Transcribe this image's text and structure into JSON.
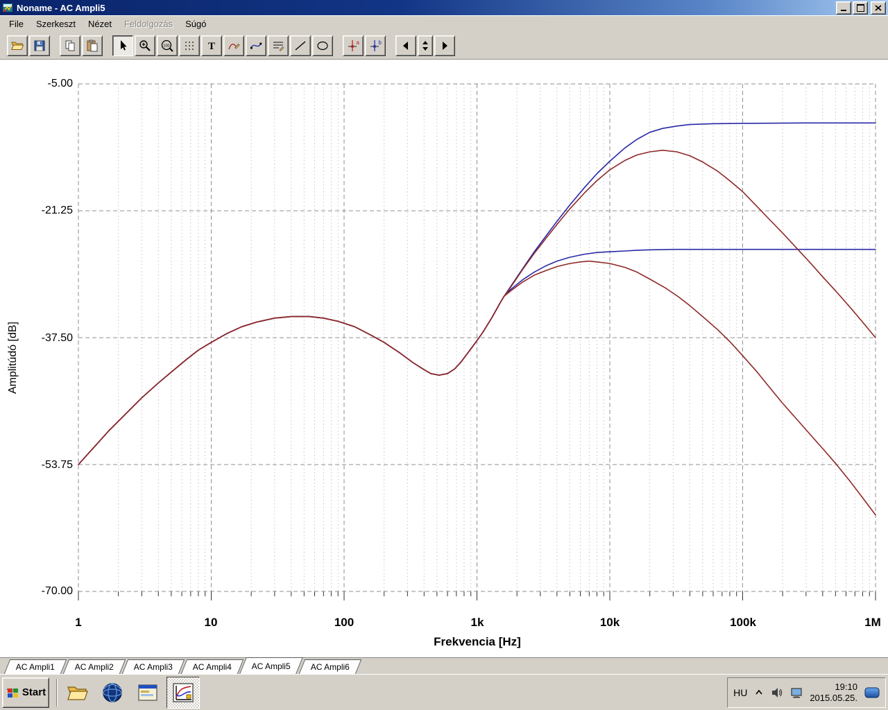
{
  "window": {
    "title": "Noname - AC Ampli5"
  },
  "menu": {
    "items": [
      {
        "label": "File",
        "enabled": true
      },
      {
        "label": "Szerkeszt",
        "enabled": true
      },
      {
        "label": "Nézet",
        "enabled": true
      },
      {
        "label": "Feldolgozás",
        "enabled": false
      },
      {
        "label": "Súgó",
        "enabled": true
      }
    ]
  },
  "toolbar": {
    "text_tool_label": "T",
    "zoom_100_label": "100",
    "cursor_a_label": "a",
    "cursor_b_label": "b"
  },
  "chart_data": {
    "type": "line",
    "title": "",
    "xlabel": "Frekvencia [Hz]",
    "ylabel": "Amplitúdó [dB]",
    "x_scale": "log",
    "xlim": [
      1,
      1000000
    ],
    "ylim": [
      -70,
      -5
    ],
    "y_ticks": [
      -5,
      -21.25,
      -37.5,
      -53.75,
      -70
    ],
    "y_tick_labels": [
      "-5.00",
      "-21.25",
      "-37.50",
      "-53.75",
      "-70.00"
    ],
    "x_ticks": [
      1,
      10,
      100,
      1000,
      10000,
      100000,
      1000000
    ],
    "x_tick_labels": [
      "1",
      "10",
      "100",
      "1k",
      "10k",
      "100k",
      "1M"
    ],
    "grid": true,
    "grid_major_color": "#8f8f8f",
    "grid_minor_color": "#c6c6c6",
    "blue_color": "#2828a8",
    "red_color": "#8f2828",
    "series": [
      {
        "name": "blue_upper",
        "color": "#2828a8",
        "points": [
          [
            1,
            -53.75
          ],
          [
            1.3,
            -51.6
          ],
          [
            1.7,
            -49.4
          ],
          [
            2.2,
            -47.5
          ],
          [
            3,
            -45.2
          ],
          [
            4,
            -43.3
          ],
          [
            5,
            -41.9
          ],
          [
            6.5,
            -40.3
          ],
          [
            8,
            -39.1
          ],
          [
            10,
            -38.1
          ],
          [
            13,
            -37
          ],
          [
            17,
            -36.1
          ],
          [
            22,
            -35.5
          ],
          [
            30,
            -35
          ],
          [
            40,
            -34.8
          ],
          [
            55,
            -34.8
          ],
          [
            70,
            -35
          ],
          [
            90,
            -35.4
          ],
          [
            120,
            -36.1
          ],
          [
            160,
            -37.2
          ],
          [
            200,
            -38.1
          ],
          [
            260,
            -39.4
          ],
          [
            330,
            -40.7
          ],
          [
            400,
            -41.6
          ],
          [
            450,
            -42.1
          ],
          [
            520,
            -42.3
          ],
          [
            600,
            -42.1
          ],
          [
            680,
            -41.5
          ],
          [
            760,
            -40.6
          ],
          [
            850,
            -39.5
          ],
          [
            950,
            -38.4
          ],
          [
            1100,
            -36.9
          ],
          [
            1300,
            -34.9
          ],
          [
            1500,
            -33
          ],
          [
            1600,
            -32.2
          ],
          [
            1800,
            -30.9
          ],
          [
            2200,
            -28.7
          ],
          [
            2700,
            -26.5
          ],
          [
            3300,
            -24.5
          ],
          [
            4000,
            -22.6
          ],
          [
            5000,
            -20.5
          ],
          [
            6500,
            -18.2
          ],
          [
            8000,
            -16.5
          ],
          [
            10000,
            -14.9
          ],
          [
            13000,
            -13.2
          ],
          [
            16000,
            -12.1
          ],
          [
            20000,
            -11.2
          ],
          [
            25000,
            -10.7
          ],
          [
            32000,
            -10.4
          ],
          [
            40000,
            -10.2
          ],
          [
            60000,
            -10.1
          ],
          [
            100000,
            -10.05
          ],
          [
            300000,
            -10
          ],
          [
            1000000,
            -10
          ]
        ]
      },
      {
        "name": "blue_lower",
        "color": "#2828a8",
        "points": [
          [
            1,
            -53.75
          ],
          [
            1.3,
            -51.6
          ],
          [
            1.7,
            -49.4
          ],
          [
            2.2,
            -47.5
          ],
          [
            3,
            -45.2
          ],
          [
            4,
            -43.3
          ],
          [
            5,
            -41.9
          ],
          [
            6.5,
            -40.3
          ],
          [
            8,
            -39.1
          ],
          [
            10,
            -38.1
          ],
          [
            13,
            -37
          ],
          [
            17,
            -36.1
          ],
          [
            22,
            -35.5
          ],
          [
            30,
            -35
          ],
          [
            40,
            -34.8
          ],
          [
            55,
            -34.8
          ],
          [
            70,
            -35
          ],
          [
            90,
            -35.4
          ],
          [
            120,
            -36.1
          ],
          [
            160,
            -37.2
          ],
          [
            200,
            -38.1
          ],
          [
            260,
            -39.4
          ],
          [
            330,
            -40.7
          ],
          [
            400,
            -41.6
          ],
          [
            450,
            -42.1
          ],
          [
            520,
            -42.3
          ],
          [
            600,
            -42.1
          ],
          [
            680,
            -41.5
          ],
          [
            760,
            -40.6
          ],
          [
            850,
            -39.5
          ],
          [
            950,
            -38.4
          ],
          [
            1100,
            -36.9
          ],
          [
            1300,
            -34.9
          ],
          [
            1500,
            -33
          ],
          [
            1600,
            -32.2
          ],
          [
            1800,
            -31.3
          ],
          [
            2200,
            -30.1
          ],
          [
            2700,
            -29.1
          ],
          [
            3300,
            -28.3
          ],
          [
            4000,
            -27.7
          ],
          [
            5000,
            -27.2
          ],
          [
            6500,
            -26.8
          ],
          [
            8000,
            -26.6
          ],
          [
            10000,
            -26.5
          ],
          [
            13000,
            -26.4
          ],
          [
            16000,
            -26.3
          ],
          [
            20000,
            -26.25
          ],
          [
            30000,
            -26.2
          ],
          [
            60000,
            -26.2
          ],
          [
            100000,
            -26.2
          ],
          [
            300000,
            -26.2
          ],
          [
            1000000,
            -26.2
          ]
        ]
      },
      {
        "name": "red_upper",
        "color": "#8f2828",
        "points": [
          [
            1,
            -53.75
          ],
          [
            1.3,
            -51.6
          ],
          [
            1.7,
            -49.4
          ],
          [
            2.2,
            -47.5
          ],
          [
            3,
            -45.2
          ],
          [
            4,
            -43.3
          ],
          [
            5,
            -41.9
          ],
          [
            6.5,
            -40.3
          ],
          [
            8,
            -39.1
          ],
          [
            10,
            -38.1
          ],
          [
            13,
            -37
          ],
          [
            17,
            -36.1
          ],
          [
            22,
            -35.5
          ],
          [
            30,
            -35
          ],
          [
            40,
            -34.8
          ],
          [
            55,
            -34.8
          ],
          [
            70,
            -35
          ],
          [
            90,
            -35.4
          ],
          [
            120,
            -36.1
          ],
          [
            160,
            -37.2
          ],
          [
            200,
            -38.1
          ],
          [
            260,
            -39.4
          ],
          [
            330,
            -40.7
          ],
          [
            400,
            -41.6
          ],
          [
            450,
            -42.1
          ],
          [
            520,
            -42.3
          ],
          [
            600,
            -42.1
          ],
          [
            680,
            -41.5
          ],
          [
            760,
            -40.6
          ],
          [
            850,
            -39.5
          ],
          [
            950,
            -38.4
          ],
          [
            1100,
            -36.9
          ],
          [
            1300,
            -34.9
          ],
          [
            1500,
            -33
          ],
          [
            1600,
            -32.2
          ],
          [
            1800,
            -31
          ],
          [
            2200,
            -28.8
          ],
          [
            2700,
            -26.7
          ],
          [
            3300,
            -24.8
          ],
          [
            4000,
            -23
          ],
          [
            5000,
            -21
          ],
          [
            6500,
            -18.9
          ],
          [
            8000,
            -17.4
          ],
          [
            10000,
            -16
          ],
          [
            13000,
            -14.8
          ],
          [
            16000,
            -14.1
          ],
          [
            20000,
            -13.7
          ],
          [
            25000,
            -13.5
          ],
          [
            32000,
            -13.7
          ],
          [
            40000,
            -14.2
          ],
          [
            50000,
            -15
          ],
          [
            65000,
            -16.2
          ],
          [
            80000,
            -17.4
          ],
          [
            100000,
            -18.8
          ],
          [
            130000,
            -20.8
          ],
          [
            160000,
            -22.4
          ],
          [
            200000,
            -24.1
          ],
          [
            260000,
            -26.2
          ],
          [
            330000,
            -28.1
          ],
          [
            400000,
            -29.7
          ],
          [
            500000,
            -31.5
          ],
          [
            650000,
            -33.7
          ],
          [
            800000,
            -35.5
          ],
          [
            1000000,
            -37.5
          ]
        ]
      },
      {
        "name": "red_lower",
        "color": "#8f2828",
        "points": [
          [
            1,
            -53.75
          ],
          [
            1.3,
            -51.6
          ],
          [
            1.7,
            -49.4
          ],
          [
            2.2,
            -47.5
          ],
          [
            3,
            -45.2
          ],
          [
            4,
            -43.3
          ],
          [
            5,
            -41.9
          ],
          [
            6.5,
            -40.3
          ],
          [
            8,
            -39.1
          ],
          [
            10,
            -38.1
          ],
          [
            13,
            -37
          ],
          [
            17,
            -36.1
          ],
          [
            22,
            -35.5
          ],
          [
            30,
            -35
          ],
          [
            40,
            -34.8
          ],
          [
            55,
            -34.8
          ],
          [
            70,
            -35
          ],
          [
            90,
            -35.4
          ],
          [
            120,
            -36.1
          ],
          [
            160,
            -37.2
          ],
          [
            200,
            -38.1
          ],
          [
            260,
            -39.4
          ],
          [
            330,
            -40.7
          ],
          [
            400,
            -41.6
          ],
          [
            450,
            -42.1
          ],
          [
            520,
            -42.3
          ],
          [
            600,
            -42.1
          ],
          [
            680,
            -41.5
          ],
          [
            760,
            -40.6
          ],
          [
            850,
            -39.5
          ],
          [
            950,
            -38.4
          ],
          [
            1100,
            -36.9
          ],
          [
            1300,
            -34.9
          ],
          [
            1500,
            -33
          ],
          [
            1600,
            -32.2
          ],
          [
            1800,
            -31.5
          ],
          [
            2200,
            -30.4
          ],
          [
            2700,
            -29.5
          ],
          [
            3300,
            -28.9
          ],
          [
            4000,
            -28.4
          ],
          [
            5000,
            -28
          ],
          [
            6000,
            -27.8
          ],
          [
            7000,
            -27.7
          ],
          [
            8000,
            -27.8
          ],
          [
            10000,
            -28
          ],
          [
            13000,
            -28.5
          ],
          [
            16000,
            -29.1
          ],
          [
            20000,
            -30
          ],
          [
            26000,
            -31.1
          ],
          [
            33000,
            -32.3
          ],
          [
            40000,
            -33.4
          ],
          [
            50000,
            -34.8
          ],
          [
            65000,
            -36.5
          ],
          [
            80000,
            -38
          ],
          [
            100000,
            -39.8
          ],
          [
            130000,
            -42
          ],
          [
            160000,
            -43.9
          ],
          [
            200000,
            -45.9
          ],
          [
            260000,
            -48.1
          ],
          [
            330000,
            -50.1
          ],
          [
            400000,
            -51.7
          ],
          [
            500000,
            -53.6
          ],
          [
            650000,
            -56
          ],
          [
            800000,
            -58
          ],
          [
            1000000,
            -60.2
          ]
        ]
      }
    ]
  },
  "tabs": {
    "items": [
      {
        "label": "AC Ampli1",
        "active": false
      },
      {
        "label": "AC Ampli2",
        "active": false
      },
      {
        "label": "AC Ampli3",
        "active": false
      },
      {
        "label": "AC Ampli4",
        "active": false
      },
      {
        "label": "AC Ampli5",
        "active": true
      },
      {
        "label": "AC Ampli6",
        "active": false
      }
    ]
  },
  "taskbar": {
    "start_label": "Start",
    "tray": {
      "language": "HU",
      "time": "19:10",
      "date": "2015.05.25."
    }
  }
}
